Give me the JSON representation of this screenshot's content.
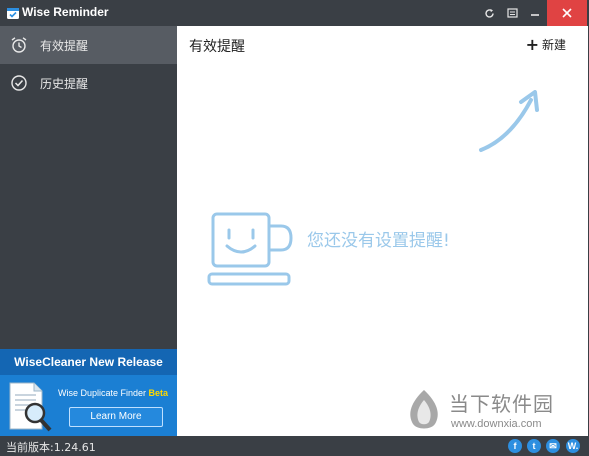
{
  "window": {
    "title": "Wise Reminder",
    "controls": {
      "refresh_icon": "refresh-icon",
      "menu_icon": "menu-icon",
      "minimize_icon": "minimize-icon",
      "close_icon": "close-icon"
    }
  },
  "sidebar": {
    "items": [
      {
        "label": "有效提醒",
        "icon": "alarm-clock-icon",
        "active": true
      },
      {
        "label": "历史提醒",
        "icon": "check-circle-icon",
        "active": false
      }
    ]
  },
  "promo": {
    "header": "WiseCleaner New Release",
    "product_name": "Wise Duplicate Finder",
    "product_tag": "Beta",
    "button_label": "Learn More"
  },
  "main": {
    "title": "有效提醒",
    "new_button": {
      "icon": "+",
      "label": "新建"
    },
    "empty_message": "您还没有设置提醒!"
  },
  "watermark": {
    "text": "当下软件园",
    "url": "www.downxia.com"
  },
  "status": {
    "version": "当前版本:1.24.61",
    "social": [
      {
        "icon": "facebook-icon",
        "glyph": "f"
      },
      {
        "icon": "twitter-icon",
        "glyph": "t"
      },
      {
        "icon": "email-icon",
        "glyph": "✉"
      },
      {
        "icon": "wise-icon",
        "glyph": "W."
      }
    ]
  },
  "colors": {
    "chrome": "#3a3f45",
    "sidebar_active": "#575c63",
    "close_button": "#e04343",
    "promo_blue": "#1b7fd3",
    "promo_beta": "#ffd800",
    "empty_state_blue": "#9ac8ea"
  }
}
